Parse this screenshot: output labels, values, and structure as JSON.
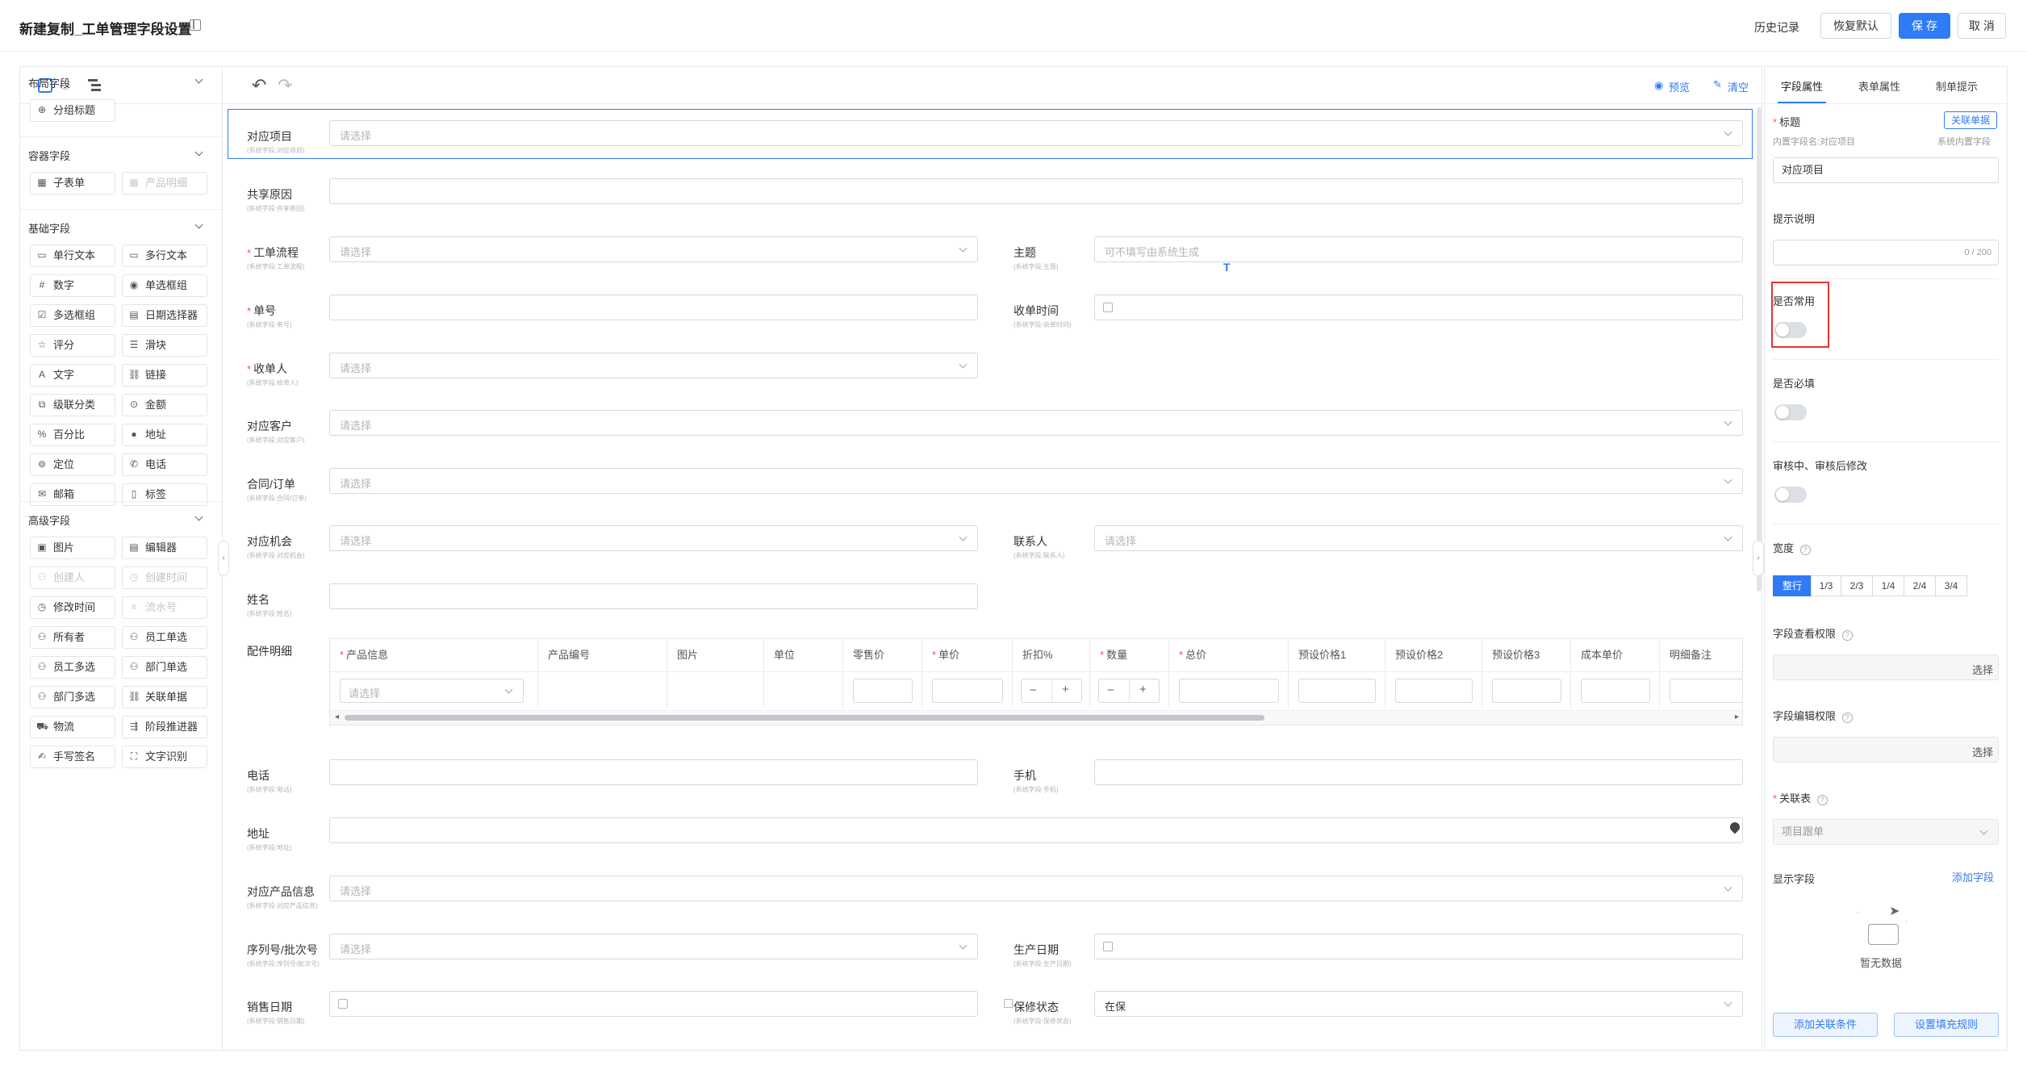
{
  "header": {
    "title": "新建复制_工单管理字段设置",
    "history": "历史记录",
    "restore": "恢复默认",
    "save": "保 存",
    "cancel": "取 消"
  },
  "toolbar": {
    "preview": "预览",
    "clear": "清空"
  },
  "left_panel": {
    "sections": [
      {
        "title": "布局字段",
        "items": [
          {
            "icon": "group-title-icon",
            "label": "分组标题",
            "enabled": true
          }
        ]
      },
      {
        "title": "容器字段",
        "items": [
          {
            "icon": "subtable-icon",
            "label": "子表单",
            "enabled": true
          },
          {
            "icon": "product-detail-icon",
            "label": "产品明细",
            "enabled": false
          }
        ]
      },
      {
        "title": "基础字段",
        "items": [
          {
            "icon": "single-text-icon",
            "label": "单行文本",
            "enabled": true
          },
          {
            "icon": "multi-text-icon",
            "label": "多行文本",
            "enabled": true
          },
          {
            "icon": "number-icon",
            "label": "数字",
            "enabled": true
          },
          {
            "icon": "radio-icon",
            "label": "单选框组",
            "enabled": true
          },
          {
            "icon": "checkbox-icon",
            "label": "多选框组",
            "enabled": true
          },
          {
            "icon": "date-icon",
            "label": "日期选择器",
            "enabled": true
          },
          {
            "icon": "star-icon",
            "label": "评分",
            "enabled": true
          },
          {
            "icon": "slider-icon",
            "label": "滑块",
            "enabled": true
          },
          {
            "icon": "text-icon",
            "label": "文字",
            "enabled": true
          },
          {
            "icon": "link-icon",
            "label": "链接",
            "enabled": true
          },
          {
            "icon": "cascade-icon",
            "label": "级联分类",
            "enabled": true
          },
          {
            "icon": "amount-icon",
            "label": "金额",
            "enabled": true
          },
          {
            "icon": "percent-icon",
            "label": "百分比",
            "enabled": true
          },
          {
            "icon": "location-pin-icon",
            "label": "地址",
            "enabled": true
          },
          {
            "icon": "locate-icon",
            "label": "定位",
            "enabled": true
          },
          {
            "icon": "phone-icon",
            "label": "电话",
            "enabled": true
          },
          {
            "icon": "mail-icon",
            "label": "邮箱",
            "enabled": true
          },
          {
            "icon": "tag-icon",
            "label": "标签",
            "enabled": true
          }
        ]
      },
      {
        "title": "高级字段",
        "items": [
          {
            "icon": "image-icon",
            "label": "图片",
            "enabled": true
          },
          {
            "icon": "editor-icon",
            "label": "编辑器",
            "enabled": true
          },
          {
            "icon": "creator-icon",
            "label": "创建人",
            "enabled": false
          },
          {
            "icon": "create-time-icon",
            "label": "创建时间",
            "enabled": false
          },
          {
            "icon": "modify-time-icon",
            "label": "修改时间",
            "enabled": true
          },
          {
            "icon": "serial-icon",
            "label": "流水号",
            "enabled": false
          },
          {
            "icon": "owner-icon",
            "label": "所有者",
            "enabled": true
          },
          {
            "icon": "user-single-icon",
            "label": "员工单选",
            "enabled": true
          },
          {
            "icon": "users-multi-icon",
            "label": "员工多选",
            "enabled": true
          },
          {
            "icon": "dept-single-icon",
            "label": "部门单选",
            "enabled": true
          },
          {
            "icon": "dept-multi-icon",
            "label": "部门多选",
            "enabled": true
          },
          {
            "icon": "relation-icon",
            "label": "关联单据",
            "enabled": true
          },
          {
            "icon": "logistics-icon",
            "label": "物流",
            "enabled": true
          },
          {
            "icon": "stage-icon",
            "label": "阶段推进器",
            "enabled": true
          },
          {
            "icon": "signature-icon",
            "label": "手写签名",
            "enabled": true
          },
          {
            "icon": "ocr-icon",
            "label": "文字识别",
            "enabled": true
          }
        ]
      }
    ]
  },
  "form": {
    "fields": [
      {
        "key": "project",
        "label": "对应项目",
        "sub": "(系统字段:对应项目)",
        "placeholder": "请选择",
        "required": false
      },
      {
        "key": "share_reason",
        "label": "共享原因",
        "sub": "(系统字段:共享原因)",
        "placeholder": "",
        "required": false
      },
      {
        "key": "workflow",
        "label": "工单流程",
        "sub": "(系统字段:工单流程)",
        "placeholder": "请选择",
        "required": true
      },
      {
        "key": "subject",
        "label": "主题",
        "sub": "(系统字段:主题)",
        "placeholder": "可不填写由系统生成",
        "required": false
      },
      {
        "key": "number",
        "label": "单号",
        "sub": "(系统字段:单号)",
        "placeholder": "",
        "required": true
      },
      {
        "key": "receive_time",
        "label": "收单时间",
        "sub": "(系统字段:收单时间)",
        "placeholder": "",
        "required": false
      },
      {
        "key": "receiver",
        "label": "收单人",
        "sub": "(系统字段:收单人)",
        "placeholder": "请选择",
        "required": true
      },
      {
        "key": "customer",
        "label": "对应客户",
        "sub": "(系统字段:对应客户)",
        "placeholder": "请选择",
        "required": false
      },
      {
        "key": "contract",
        "label": "合同/订单",
        "sub": "(系统字段:合同/订单)",
        "placeholder": "请选择",
        "required": false
      },
      {
        "key": "opportunity",
        "label": "对应机会",
        "sub": "(系统字段:对应机会)",
        "placeholder": "请选择",
        "required": false
      },
      {
        "key": "contact",
        "label": "联系人",
        "sub": "(系统字段:联系人)",
        "placeholder": "请选择",
        "required": false
      },
      {
        "key": "name",
        "label": "姓名",
        "sub": "(系统字段:姓名)",
        "placeholder": "",
        "required": false
      },
      {
        "key": "parts",
        "label": "配件明细",
        "sub": "",
        "placeholder": "",
        "required": false
      },
      {
        "key": "phone",
        "label": "电话",
        "sub": "(系统字段:电话)",
        "placeholder": "",
        "required": false
      },
      {
        "key": "mobile",
        "label": "手机",
        "sub": "(系统字段:手机)",
        "placeholder": "",
        "required": false
      },
      {
        "key": "address",
        "label": "地址",
        "sub": "(系统字段:地址)",
        "placeholder": "",
        "required": false
      },
      {
        "key": "product_info",
        "label": "对应产品信息",
        "sub": "(系统字段:对应产品信息)",
        "placeholder": "请选择",
        "required": false
      },
      {
        "key": "serial",
        "label": "序列号/批次号",
        "sub": "(系统字段:序列号/批次号)",
        "placeholder": "请选择",
        "required": false
      },
      {
        "key": "prod_date",
        "label": "生产日期",
        "sub": "(系统字段:生产日期)",
        "placeholder": "",
        "required": false
      },
      {
        "key": "sale_date",
        "label": "销售日期",
        "sub": "(系统字段:销售日期)",
        "placeholder": "",
        "required": false
      },
      {
        "key": "warranty",
        "label": "保修状态",
        "sub": "(系统字段:保修状态)",
        "placeholder": "在保",
        "required": false
      }
    ],
    "parts_table": {
      "columns": [
        {
          "label": "产品信息",
          "required": true
        },
        {
          "label": "产品编号",
          "required": false
        },
        {
          "label": "图片",
          "required": false
        },
        {
          "label": "单位",
          "required": false
        },
        {
          "label": "零售价",
          "required": false
        },
        {
          "label": "单价",
          "required": true
        },
        {
          "label": "折扣%",
          "required": false
        },
        {
          "label": "数量",
          "required": true
        },
        {
          "label": "总价",
          "required": true
        },
        {
          "label": "预设价格1",
          "required": false
        },
        {
          "label": "预设价格2",
          "required": false
        },
        {
          "label": "预设价格3",
          "required": false
        },
        {
          "label": "成本单价",
          "required": false
        },
        {
          "label": "明细备注",
          "required": false
        }
      ],
      "row_placeholder": "请选择",
      "minus": "−",
      "plus": "+"
    }
  },
  "right_panel": {
    "tabs": [
      "字段属性",
      "表单属性",
      "制单提示"
    ],
    "active_tab": 0,
    "title_label": "标题",
    "link_doc_button": "关联单据",
    "inner_field_name": "内置字段名:对应项目",
    "system_inner": "系统内置字段",
    "title_value": "对应项目",
    "hint_label": "提示说明",
    "hint_counter": "0 / 200",
    "common_label": "是否常用",
    "required_label": "是否必填",
    "review_label": "审核中、审核后修改",
    "width_label": "宽度",
    "width_options": [
      "整行",
      "1/3",
      "2/3",
      "1/4",
      "2/4",
      "3/4"
    ],
    "width_selected": 0,
    "view_perm_label": "字段查看权限",
    "edit_perm_label": "字段编辑权限",
    "select_btn": "选择",
    "relation_table_label": "关联表",
    "relation_table_value": "项目跟单",
    "display_fields_label": "显示字段",
    "add_field": "添加字段",
    "empty_text": "暂无数据",
    "add_condition": "添加关联条件",
    "fill_rule": "设置填充规则",
    "highlight_color": "#e8322f"
  },
  "colors": {
    "primary": "#2f7bf5",
    "required": "#f5574c",
    "border": "#d6d9de"
  }
}
